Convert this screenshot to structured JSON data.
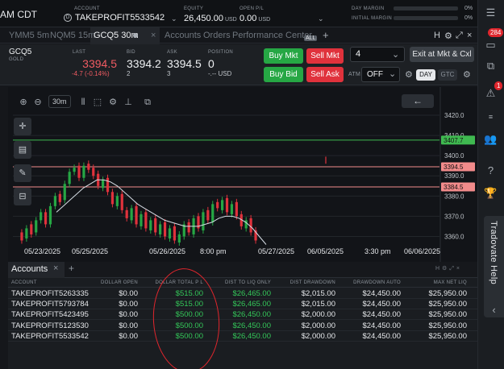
{
  "topbar": {
    "clock": "AM CDT",
    "account_label": "ACCOUNT",
    "account_value": "TAKEPROFIT5533542",
    "equity_label": "EQUITY",
    "equity_value": "26,450.00",
    "equity_unit": "USD",
    "open_pl_label": "OPEN P/L",
    "open_pl_value": "0.00",
    "open_pl_unit": "USD",
    "day_margin_label": "DAY MARGIN",
    "day_margin_pct": "0%",
    "initial_margin_label": "INITIAL MARGIN",
    "initial_margin_pct": "0%"
  },
  "sidebar": {
    "badge_top": "284",
    "badge_alert": "1",
    "help_label": "Tradovate Help"
  },
  "tabs": [
    {
      "label": "YMM5 5m"
    },
    {
      "label": "NQM5 15m"
    },
    {
      "label": "GCQ5 30m"
    },
    {
      "label": "Accounts"
    },
    {
      "label": "Orders"
    },
    {
      "label": "Performance Center"
    }
  ],
  "tabs_all_badge": "ALL",
  "tab_right_icons": {
    "h": "H"
  },
  "quote": {
    "symbol": "GCQ5",
    "symbol_sub": "GOLD",
    "last_label": "LAST",
    "last_value": "3394.5",
    "last_change": "-4.7 (-0.14%)",
    "bid_label": "BID",
    "bid_value": "3394.2",
    "bid_size": "2",
    "ask_label": "ASK",
    "ask_value": "3394.5",
    "ask_size": "3",
    "position_label": "POSITION",
    "position_value": "0",
    "position_sub": "-.-- USD"
  },
  "order": {
    "buy_mkt": "Buy Mkt",
    "sell_mkt": "Sell Mkt",
    "buy_bid": "Buy Bid",
    "sell_ask": "Sell Ask",
    "qty": "4",
    "exit_label": "Exit at Mkt & Cxl",
    "atm_label": "ATM",
    "atm_value": "OFF",
    "day": "DAY",
    "gtc": "GTC"
  },
  "chart_toolbar": {
    "interval": "30m"
  },
  "chart_data": {
    "type": "line",
    "y_ticks": [
      3420.0,
      3410.0,
      3400.0,
      3390.0,
      3380.0,
      3370.0,
      3360.0
    ],
    "ylim": [
      3355,
      3422
    ],
    "price_labels": [
      {
        "value": 3407.7,
        "label": "3407.7",
        "color": "#3fb950"
      },
      {
        "value": 3394.5,
        "label": "3394.5",
        "color": "#f28b8b"
      },
      {
        "value": 3384.5,
        "label": "3384.5",
        "color": "#f28b8b"
      }
    ],
    "x_ticks": [
      "05/23/2025",
      "05/25/2025",
      "05/26/2025",
      "8:00 pm",
      "05/27/2025",
      "06/05/2025",
      "3:30 pm",
      "06/06/2025"
    ],
    "candles_close": [
      3358,
      3364,
      3361,
      3368,
      3372,
      3366,
      3375,
      3380,
      3377,
      3386,
      3392,
      3394,
      3389,
      3395,
      3393,
      3390,
      3385,
      3388,
      3382,
      3376,
      3380,
      3373,
      3369,
      3374,
      3366,
      3371,
      3364,
      3368,
      3362,
      3366,
      3360,
      3364,
      3358,
      3361,
      3366,
      3362,
      3369,
      3364,
      3372,
      3368,
      3376,
      3374,
      3378,
      3372,
      3376,
      3370,
      3365,
      3368,
      3362,
      3358
    ],
    "candles_open": [
      3362,
      3359,
      3366,
      3362,
      3368,
      3372,
      3366,
      3375,
      3381,
      3378,
      3386,
      3392,
      3395,
      3389,
      3396,
      3394,
      3391,
      3384,
      3389,
      3382,
      3375,
      3381,
      3373,
      3368,
      3375,
      3365,
      3372,
      3363,
      3369,
      3361,
      3367,
      3359,
      3365,
      3357,
      3360,
      3367,
      3361,
      3370,
      3363,
      3373,
      3367,
      3377,
      3373,
      3379,
      3371,
      3377,
      3371,
      3364,
      3369,
      3363
    ],
    "ma": [
      3372,
      3375,
      3378,
      3381,
      3384,
      3386,
      3388,
      3388,
      3387,
      3385,
      3382,
      3379,
      3376,
      3374,
      3372,
      3370,
      3368,
      3367,
      3366,
      3365,
      3365,
      3365,
      3366,
      3367,
      3369,
      3370,
      3370,
      3369,
      3367,
      3364,
      3360,
      3356
    ]
  },
  "panel": {
    "tab": "Accounts",
    "headers": [
      "ACCOUNT",
      "DOLLAR OPEN",
      "DOLLAR TOTAL P L",
      "DIST TO LIQ ONLY",
      "DIST DRAWDOWN",
      "DRAWDOWN AUTO",
      "MAX NET LIQ"
    ],
    "rows": [
      [
        "TAKEPROFIT5263335",
        "$0.00",
        "$515.00",
        "$26,465.00",
        "$2,015.00",
        "$24,450.00",
        "$25,950.00"
      ],
      [
        "TAKEPROFIT5793784",
        "$0.00",
        "$515.00",
        "$26,465.00",
        "$2,015.00",
        "$24,450.00",
        "$25,950.00"
      ],
      [
        "TAKEPROFIT5423495",
        "$0.00",
        "$500.00",
        "$26,450.00",
        "$2,000.00",
        "$24,450.00",
        "$25,950.00"
      ],
      [
        "TAKEPROFIT5123530",
        "$0.00",
        "$500.00",
        "$26,450.00",
        "$2,000.00",
        "$24,450.00",
        "$25,950.00"
      ],
      [
        "TAKEPROFIT5533542",
        "$0.00",
        "$500.00",
        "$26,450.00",
        "$2,000.00",
        "$24,450.00",
        "$25,950.00"
      ]
    ]
  },
  "colors": {
    "accent_green": "#26a744",
    "accent_red": "#e0323c",
    "pl_green": "#34c759",
    "candle_up": "#26a744",
    "candle_down": "#e0323c"
  }
}
